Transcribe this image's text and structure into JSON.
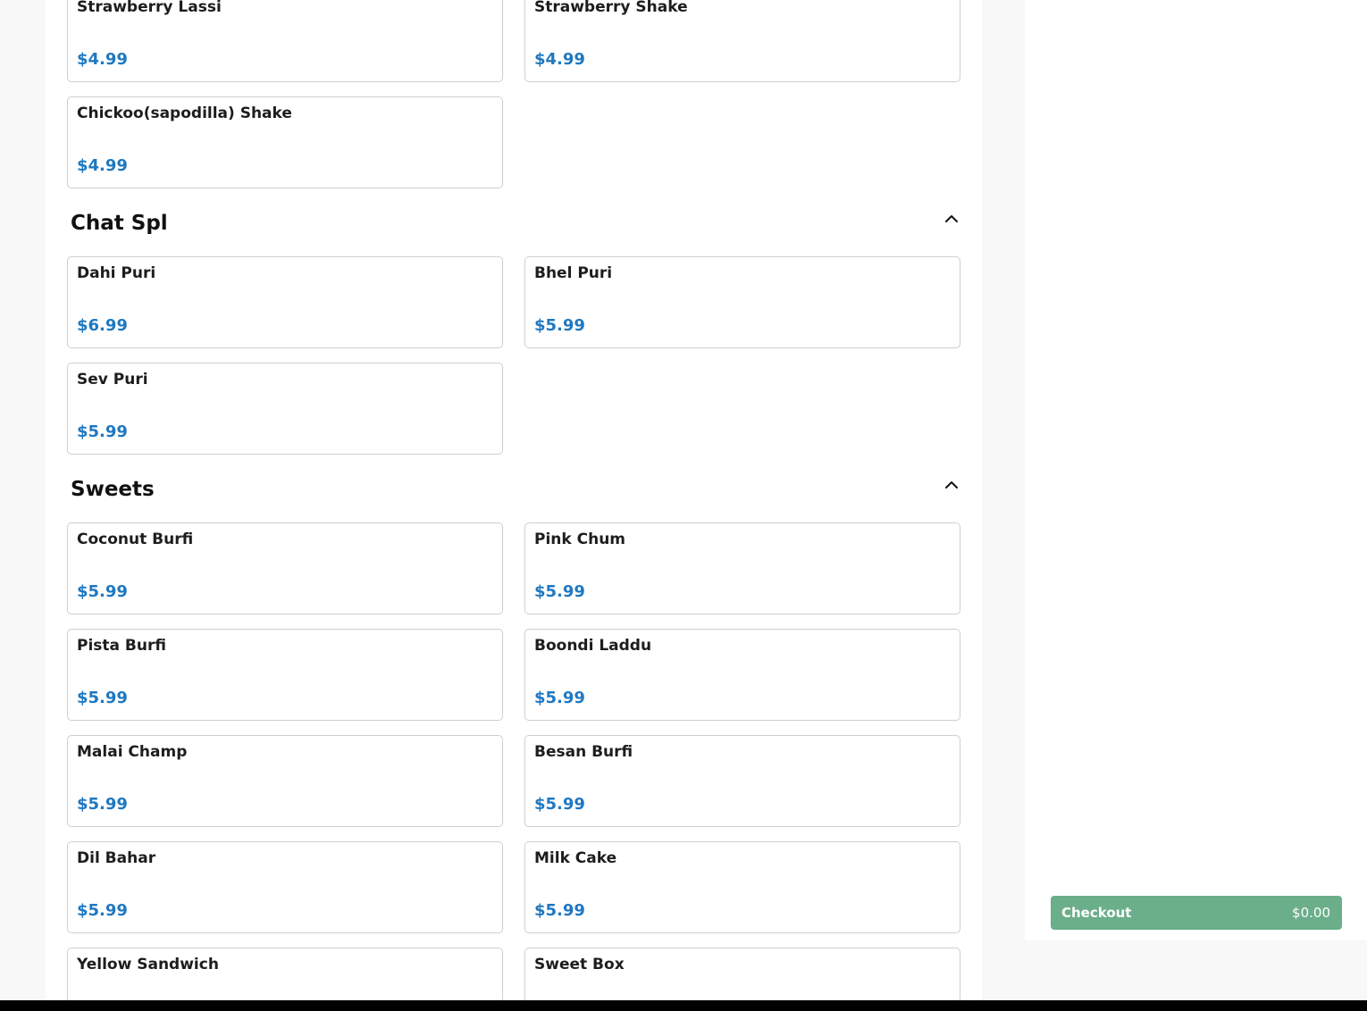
{
  "menu": {
    "top_items": [
      {
        "name": "Strawberry Lassi",
        "price": "$4.99"
      },
      {
        "name": "Strawberry Shake",
        "price": "$4.99"
      },
      {
        "name": "Chickoo(sapodilla) Shake",
        "price": "$4.99"
      }
    ],
    "sections": [
      {
        "title": "Chat Spl",
        "items": [
          {
            "name": "Dahi Puri",
            "price": "$6.99"
          },
          {
            "name": "Bhel Puri",
            "price": "$5.99"
          },
          {
            "name": "Sev Puri",
            "price": "$5.99"
          }
        ]
      },
      {
        "title": "Sweets",
        "items": [
          {
            "name": "Coconut Burfi",
            "price": "$5.99"
          },
          {
            "name": "Pink Chum",
            "price": "$5.99"
          },
          {
            "name": "Pista Burfi",
            "price": "$5.99"
          },
          {
            "name": "Boondi Laddu",
            "price": "$5.99"
          },
          {
            "name": "Malai Champ",
            "price": "$5.99"
          },
          {
            "name": "Besan Burfi",
            "price": "$5.99"
          },
          {
            "name": "Dil Bahar",
            "price": "$5.99"
          },
          {
            "name": "Milk Cake",
            "price": "$5.99"
          },
          {
            "name": "Yellow Sandwich",
            "price": ""
          },
          {
            "name": "Sweet Box",
            "price": ""
          }
        ]
      }
    ],
    "collapse_icon": "chevron-up-icon"
  },
  "cart": {
    "checkout_label": "Checkout",
    "total": "$0.00"
  },
  "colors": {
    "price": "#1f78c1",
    "checkout_bg": "#6aae8a",
    "card_border": "#cfcfcf",
    "page_bg": "#f8f8f8"
  }
}
